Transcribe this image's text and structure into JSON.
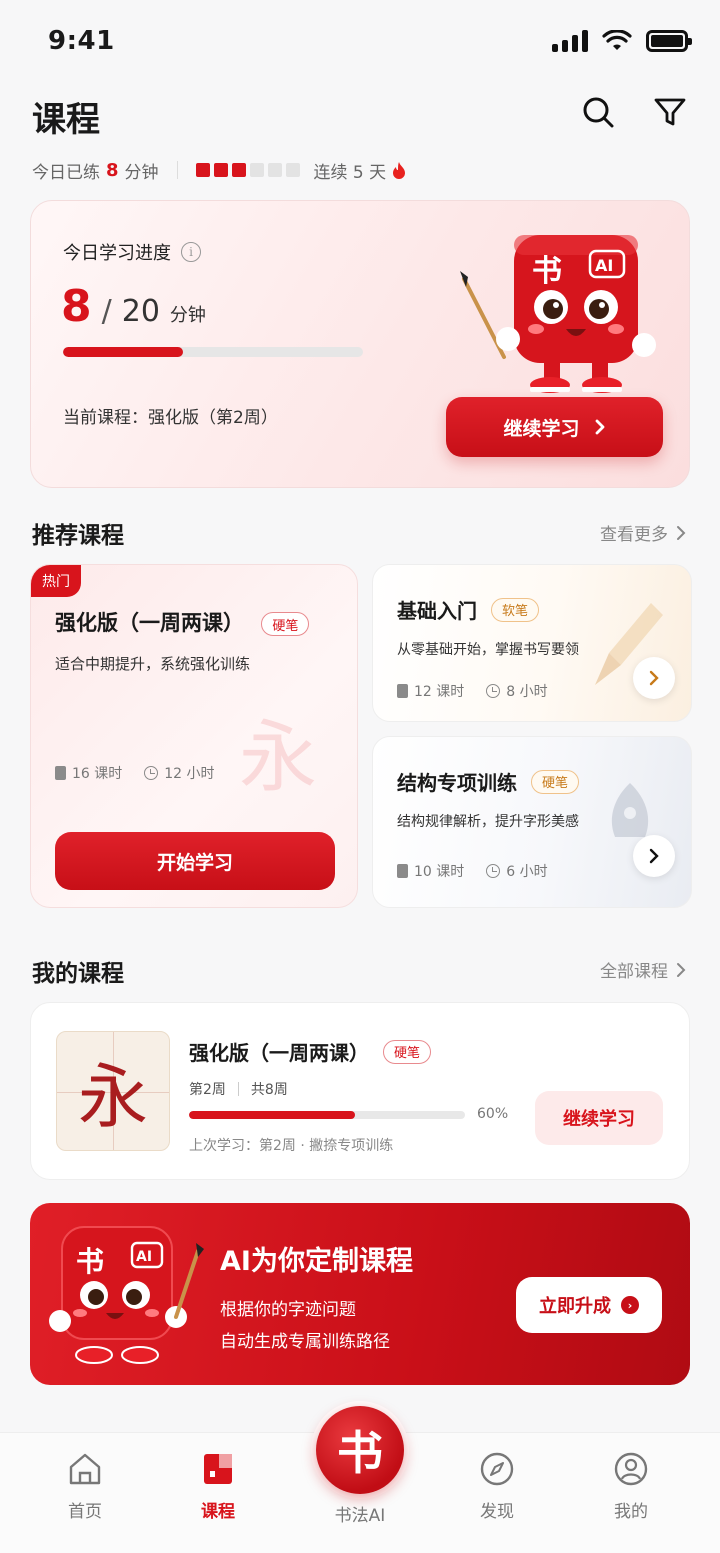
{
  "status_bar": {
    "time": "9:41"
  },
  "header": {
    "title": "课程"
  },
  "stats": {
    "practiced_prefix": "今日已练",
    "practiced_minutes": "8",
    "practiced_unit": "分钟",
    "streak_label": "连续 5 天",
    "streak_blocks_filled": 3,
    "streak_blocks_total": 6
  },
  "progress_card": {
    "title": "今日学习进度",
    "current": "8",
    "total": "20",
    "unit": "分钟",
    "progress_fraction": 0.4,
    "current_course": "当前课程：强化版（第2周）",
    "button_label": "继续学习",
    "mascot_char": "书",
    "mascot_badge": "AI"
  },
  "recommended": {
    "title": "推荐课程",
    "more": "查看更多",
    "featured": {
      "badge": "热门",
      "title": "强化版（一周两课）",
      "tag": "硬笔",
      "desc": "适合中期提升，系统强化训练",
      "lessons": "16 课时",
      "hours": "12 小时",
      "watermark": "永",
      "button": "开始学习"
    },
    "items": [
      {
        "title": "基础入门",
        "tag": "软笔",
        "desc": "从零基础开始，掌握书写要领",
        "lessons": "12 课时",
        "hours": "8 小时"
      },
      {
        "title": "结构专项训练",
        "tag": "硬笔",
        "desc": "结构规律解析，提升字形美感",
        "lessons": "10 课时",
        "hours": "6 小时"
      }
    ]
  },
  "my_courses": {
    "title": "我的课程",
    "more": "全部课程",
    "course": {
      "thumb_char": "永",
      "title": "强化版（一周两课）",
      "tag": "硬笔",
      "week": "第2周",
      "total_weeks": "共8周",
      "progress_fraction": 0.6,
      "percent_label": "60%",
      "last_study": "上次学习：第2周 · 撇捺专项训练",
      "button": "继续学习"
    }
  },
  "ai_banner": {
    "title": "AI为你定制课程",
    "line1": "根据你的字迹问题",
    "line2": "自动生成专属训练路径",
    "button": "立即升成",
    "mascot_char": "书",
    "mascot_badge": "AI"
  },
  "tabbar": {
    "tabs": [
      {
        "label": "首页",
        "icon": "home-icon"
      },
      {
        "label": "课程",
        "icon": "course-book-icon",
        "active": true
      },
      {
        "label": "书法AI",
        "icon": "calligraphy-ai-icon",
        "center_char": "书"
      },
      {
        "label": "发现",
        "icon": "compass-icon"
      },
      {
        "label": "我的",
        "icon": "profile-icon"
      }
    ]
  },
  "colors": {
    "accent": "#d8141c",
    "background": "#f7f7f8"
  }
}
